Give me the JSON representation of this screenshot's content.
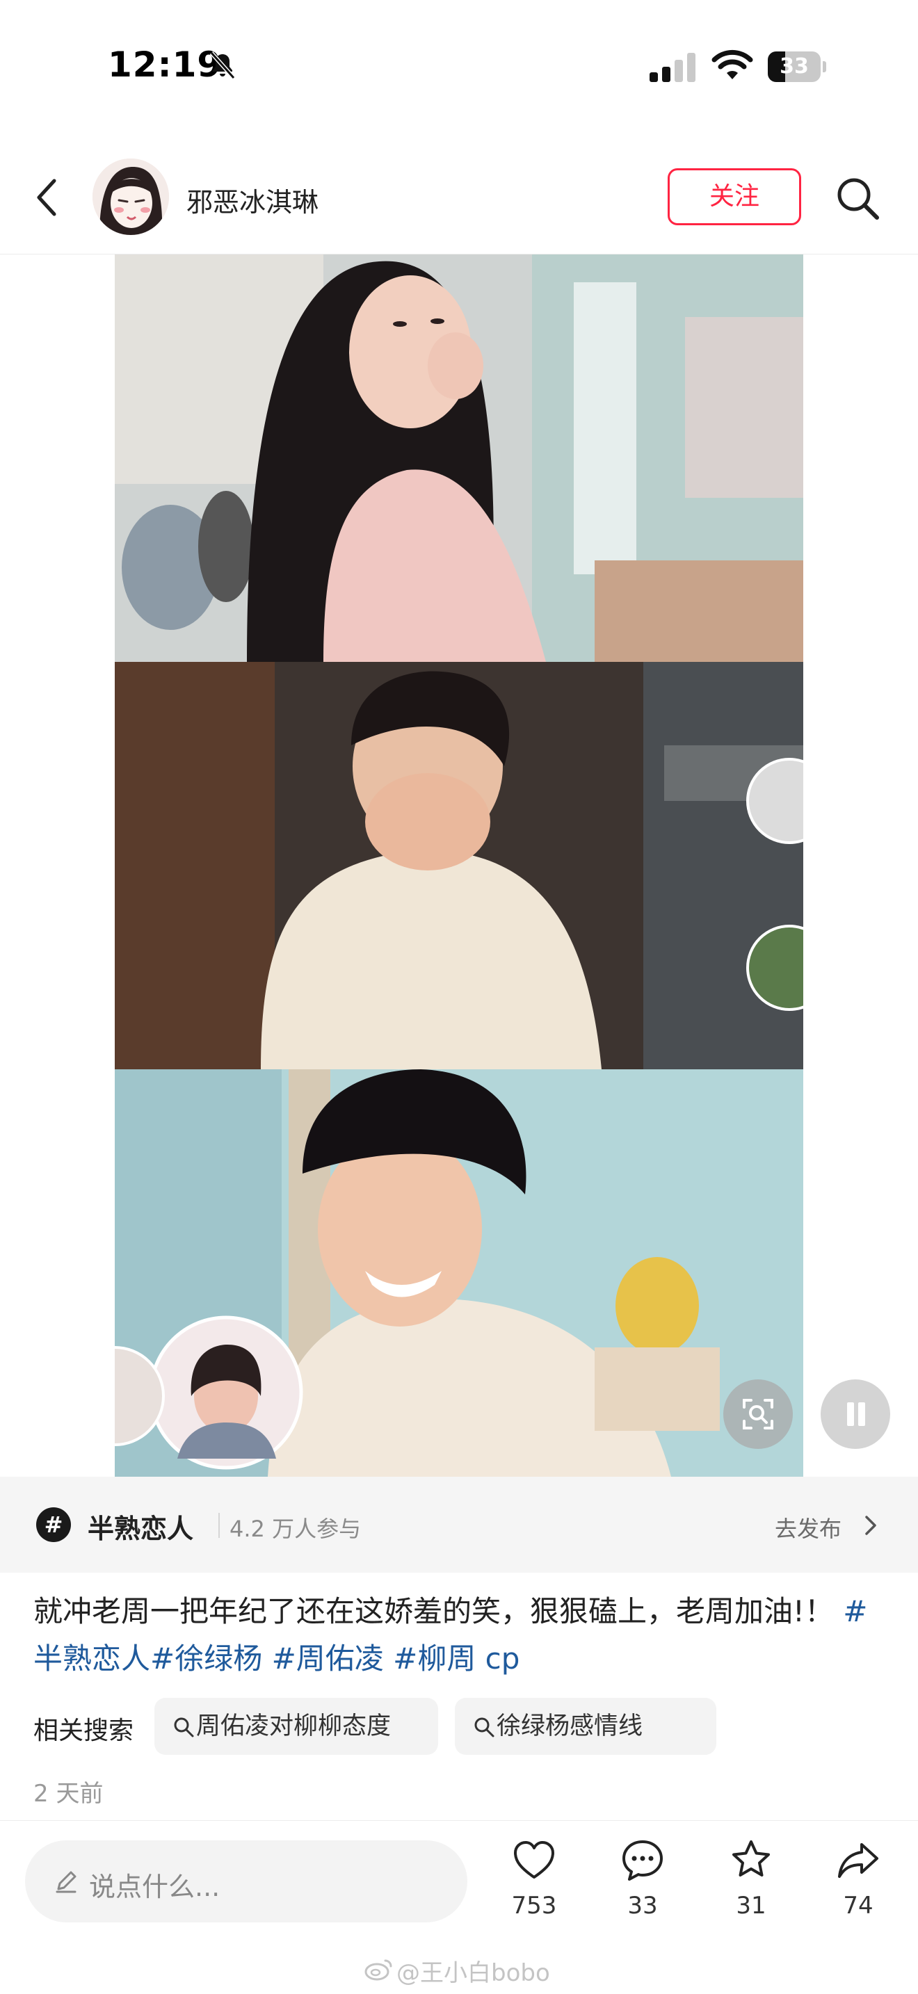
{
  "status_bar": {
    "time": "12:19",
    "battery": "33",
    "battery_level": 0.33
  },
  "header": {
    "author": "邪恶冰淇琳",
    "follow_label": "关注"
  },
  "topic": {
    "icon": "#",
    "name": "半熟恋人",
    "participants": "4.2 万人参与",
    "publish_label": "去发布"
  },
  "caption": {
    "text": "就冲老周一把年纪了还在这娇羞的笑，狠狠磕上，老周加油!！",
    "hashtags": [
      "#半熟恋人",
      "#徐绿杨",
      "#周佑凌",
      "#柳周 cp"
    ]
  },
  "related": {
    "label": "相关搜索",
    "items": [
      "周佑凌对柳柳态度",
      "徐绿杨感情线"
    ]
  },
  "timestamp": "2 天前",
  "bottom": {
    "comment_placeholder": "说点什么...",
    "likes": "753",
    "comments": "33",
    "collects": "31",
    "shares": "74"
  },
  "watermark": "@王小白bobo",
  "icons": [
    "bell-slash-icon",
    "signal-icon",
    "wifi-icon",
    "back-icon",
    "search-icon",
    "chevron-right-icon",
    "heart-icon",
    "comment-icon",
    "star-icon",
    "share-icon",
    "pencil-icon",
    "weibo-icon"
  ],
  "colors": {
    "accent": "#ff2442",
    "hashtag": "#1f5a9c"
  }
}
